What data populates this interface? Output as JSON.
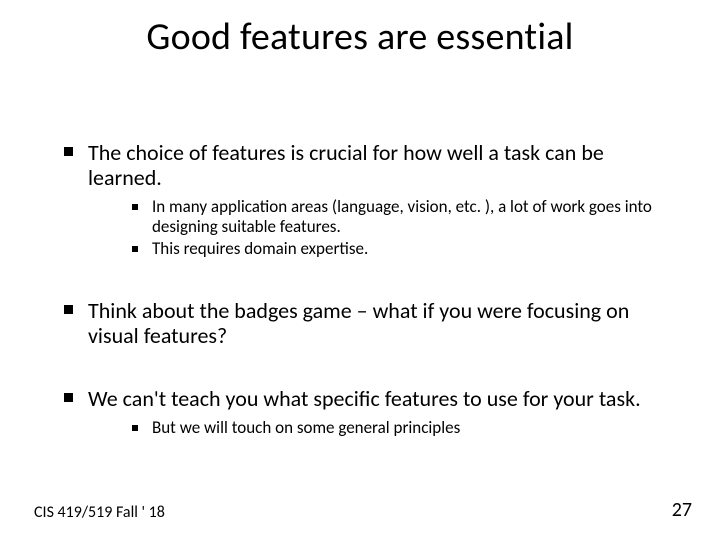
{
  "title": "Good features are essential",
  "bullets": [
    {
      "text": "The choice of features is crucial for how well a task can be learned.",
      "sub": [
        "In many application areas (language, vision, etc. ),  a lot of work goes into designing suitable features.",
        "This requires domain expertise."
      ]
    },
    {
      "text": "Think about the badges game – what if you were focusing on visual features?",
      "sub": []
    },
    {
      "text": "We can't teach you what specific features to use for your task.",
      "sub": [
        "But we will touch on some general principles"
      ]
    }
  ],
  "footer": {
    "left": "CIS 419/519 Fall ' 18",
    "right": "27"
  }
}
